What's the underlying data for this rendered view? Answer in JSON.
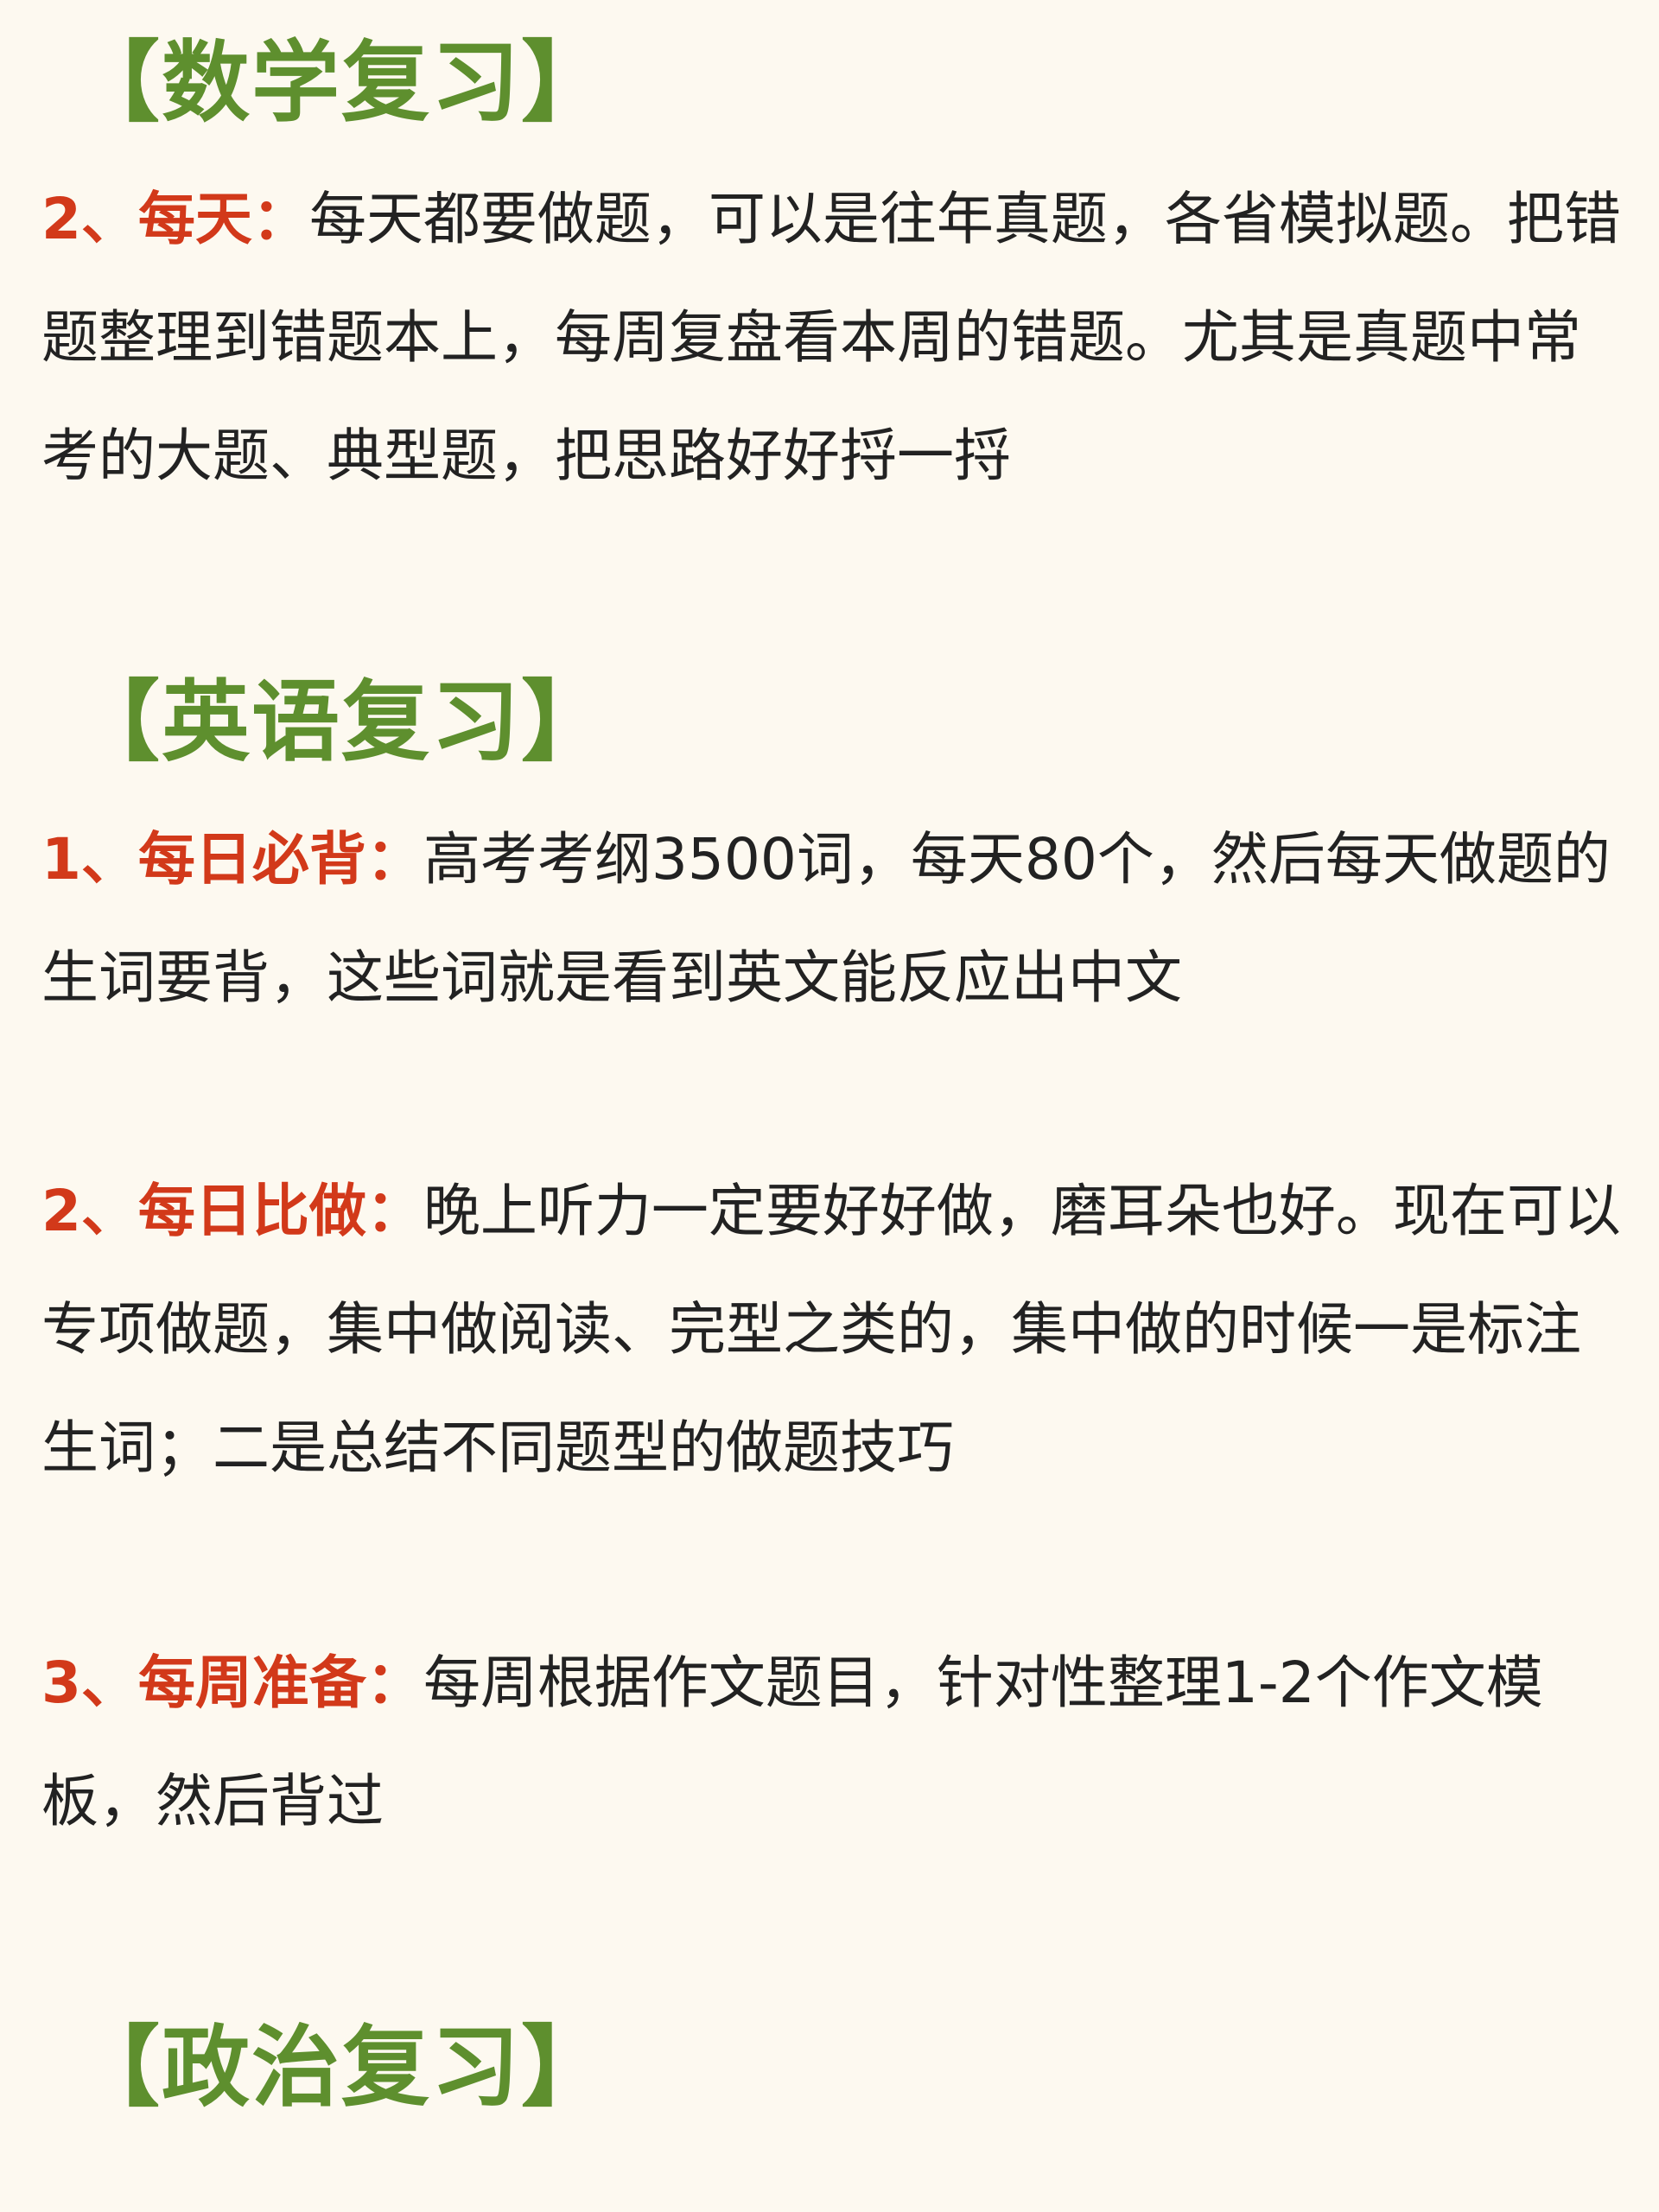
{
  "sections": [
    {
      "heading": "【数学复习】",
      "items": [
        {
          "label": "2、每天：",
          "text": "每天都要做题，可以是往年真题，各省模拟题。把错题整理到错题本上，每周复盘看本周的错题。尤其是真题中常考的大题、典型题，把思路好好捋一捋"
        }
      ]
    },
    {
      "heading": "【英语复习】",
      "items": [
        {
          "label": "1、每日必背：",
          "text": "高考考纲3500词，每天80个，然后每天做题的生词要背，这些词就是看到英文能反应出中文"
        },
        {
          "label": "2、每日比做：",
          "text": "晚上听力一定要好好做，磨耳朵也好。现在可以专项做题，集中做阅读、完型之类的，集中做的时候一是标注生词；二是总结不同题型的做题技巧"
        },
        {
          "label": "3、每周准备：",
          "text": "每周根据作文题目，针对性整理1-2个作文模板，然后背过"
        }
      ]
    },
    {
      "heading": "【政治复习】",
      "items": []
    }
  ],
  "colors": {
    "background": "#FDF9F0",
    "heading": "#5E8F2E",
    "label": "#D2391A",
    "body_text": "#222222"
  }
}
